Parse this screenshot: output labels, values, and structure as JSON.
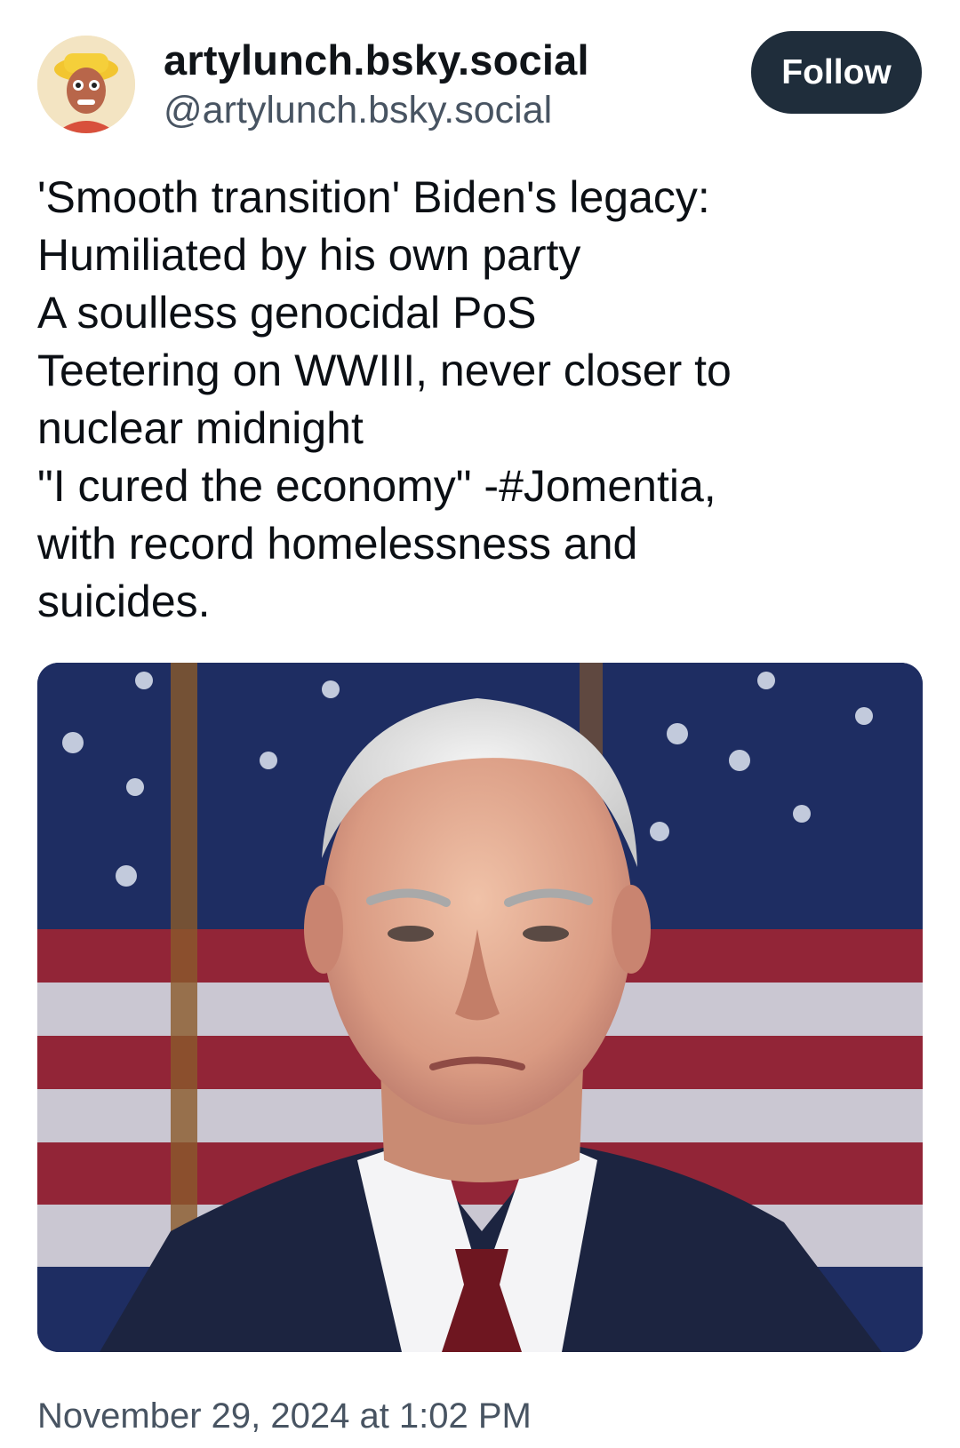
{
  "author": {
    "display_name": "artylunch.bsky.social",
    "handle": "@artylunch.bsky.social",
    "avatar_icon": "cartoon-portrait-avatar"
  },
  "follow_label": "Follow",
  "post": {
    "lines": [
      "'Smooth transition' Biden's legacy:",
      "Humiliated by his own party",
      "A soulless genocidal PoS",
      "Teetering on WWIII, never closer to",
      "nuclear midnight",
      "\"I cured the economy\" -#Jomentia,",
      "with record homelessness and",
      "suicides."
    ],
    "image_icon": "photo-of-man-in-suit-before-us-flags"
  },
  "timestamp": "November 29, 2024 at 1:02 PM",
  "colors": {
    "follow_bg": "#1f2d3b",
    "muted_text": "#485462"
  }
}
